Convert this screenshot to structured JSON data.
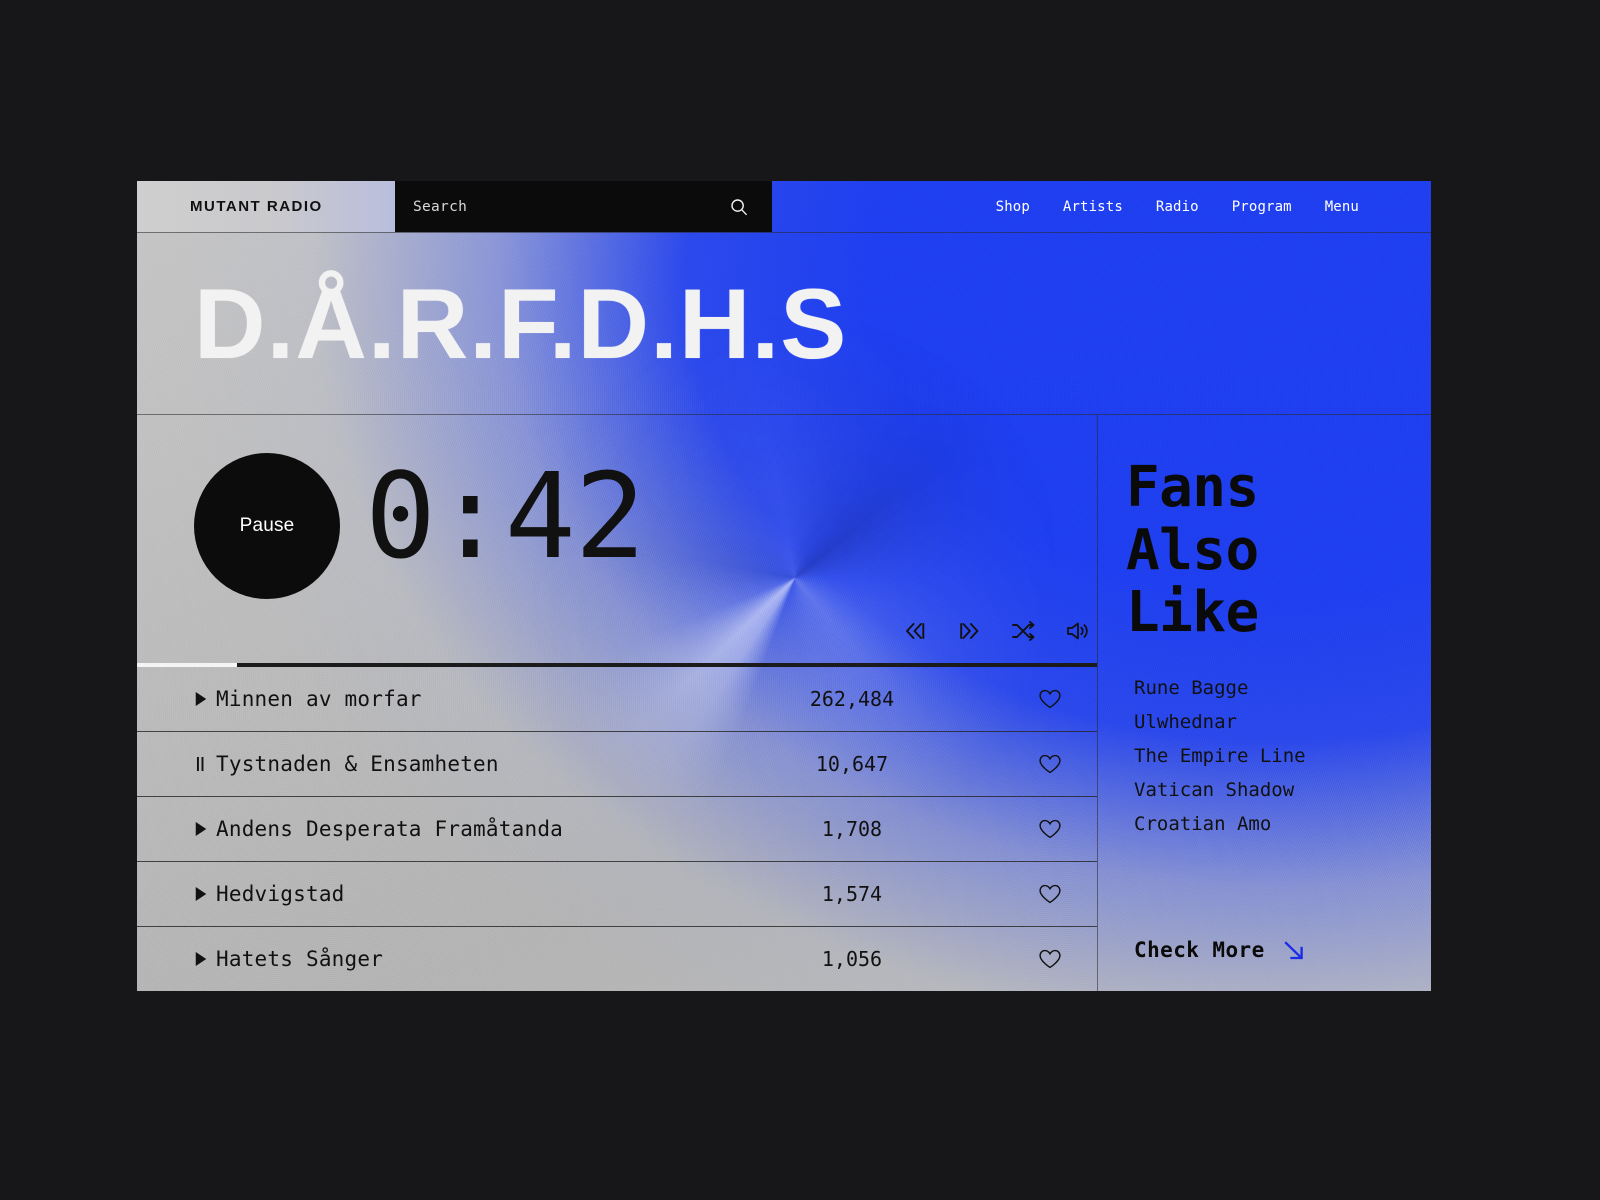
{
  "colors": {
    "accent_blue": "#1F3FE0",
    "arrow_blue": "#1A2BE8",
    "panel_grey": "#BDBDBD",
    "black": "#0B0B0C",
    "page_background": "#17171A"
  },
  "topbar": {
    "brand": "MUTANT RADIO",
    "search": {
      "placeholder": "Search",
      "value": "",
      "icon": "search-icon"
    },
    "nav": [
      {
        "label": "Shop"
      },
      {
        "label": "Artists"
      },
      {
        "label": "Radio"
      },
      {
        "label": "Program"
      },
      {
        "label": "Menu"
      }
    ]
  },
  "hero": {
    "title": "D.Å.R.F.D.H.S"
  },
  "player": {
    "pause_label": "Pause",
    "timecode": "0:42",
    "progress_percent": 10.4,
    "transport": [
      {
        "name": "rewind-icon",
        "label": "Rewind"
      },
      {
        "name": "fast-forward-icon",
        "label": "Fast forward"
      },
      {
        "name": "shuffle-icon",
        "label": "Shuffle"
      },
      {
        "name": "volume-icon",
        "label": "Volume"
      }
    ]
  },
  "tracks": [
    {
      "name": "Minnen av morfar",
      "plays": "262,484",
      "state": "play"
    },
    {
      "name": "Tystnaden & Ensamheten",
      "plays": "10,647",
      "state": "pause"
    },
    {
      "name": "Andens Desperata Framåtanda",
      "plays": "1,708",
      "state": "play"
    },
    {
      "name": "Hedvigstad",
      "plays": "1,574",
      "state": "play"
    },
    {
      "name": "Hatets Sånger",
      "plays": "1,056",
      "state": "play"
    }
  ],
  "fans_also_like": {
    "title_lines": [
      "Fans",
      "Also",
      "Like"
    ],
    "artists": [
      {
        "name": "Rune Bagge"
      },
      {
        "name": "Ulwhednar"
      },
      {
        "name": "The Empire Line"
      },
      {
        "name": "Vatican Shadow"
      },
      {
        "name": "Croatian Amo"
      }
    ],
    "check_more_label": "Check More",
    "check_more_icon": "arrow-down-right-icon"
  }
}
